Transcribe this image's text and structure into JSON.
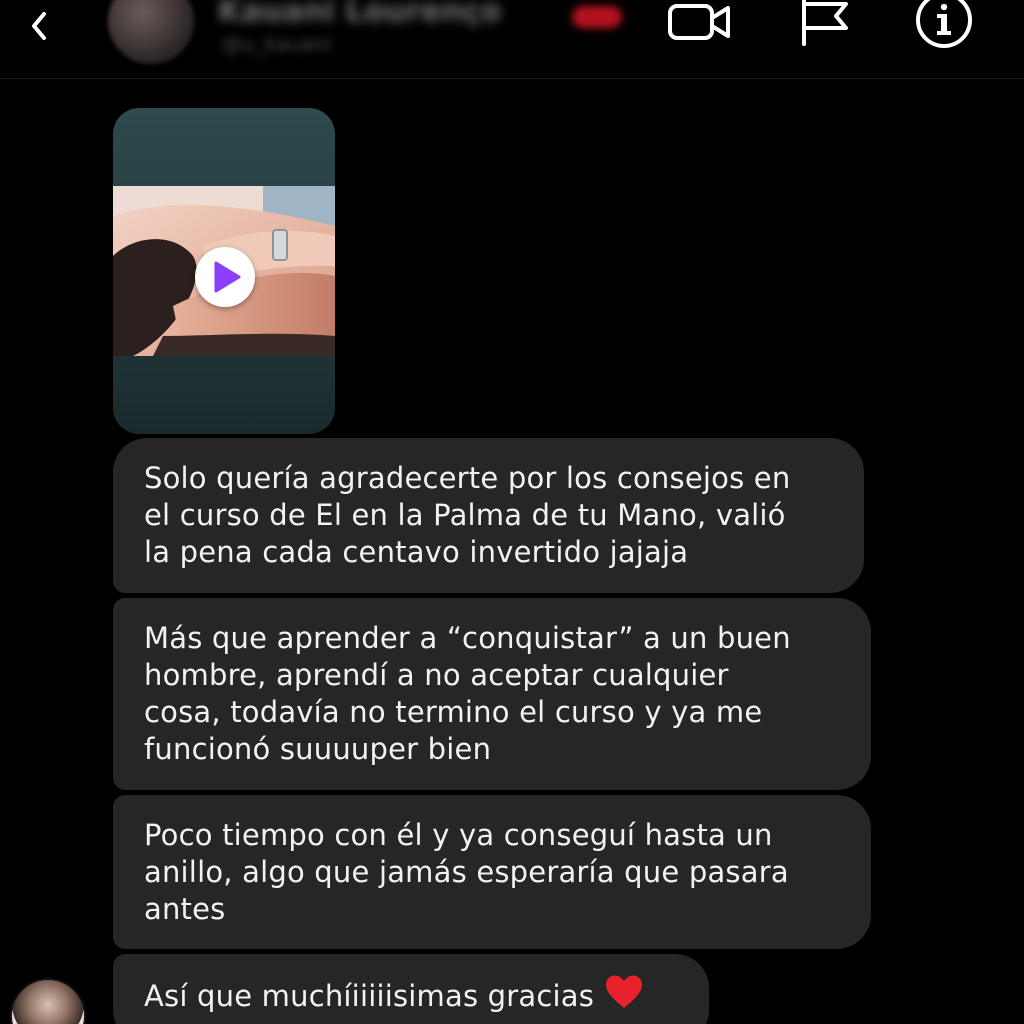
{
  "header": {
    "contact_name": "Kauani Lourenço",
    "contact_handle": "@u_kauani",
    "icons": {
      "back": "chevron-left-icon",
      "video_call": "video-camera-icon",
      "report": "flag-icon",
      "info": "info-circle-icon"
    }
  },
  "attachment": {
    "type": "video",
    "icon": "play-icon",
    "play_color": "#8a3ffc"
  },
  "messages": [
    {
      "text": "Solo quería agradecerte por los consejos en\nel curso de El en la Palma de tu Mano, valió\nla pena cada centavo invertido jajaja"
    },
    {
      "text": "Más que aprender a “conquistar” a un buen\nhombre, aprendí a no aceptar cualquier\ncosa, todavía no termino el curso y ya me\nfuncionó suuuuper bien"
    },
    {
      "text": "Poco tiempo con él y ya conseguí hasta un\nanillo, algo que jamás esperaría que pasara\nantes"
    },
    {
      "text": "Así que muchíiiiiisimas gracias",
      "emoji": "red-heart-icon"
    }
  ],
  "colors": {
    "background": "#000000",
    "bubble": "#262626",
    "text": "#f2f2f2",
    "heart": "#e8222c"
  }
}
